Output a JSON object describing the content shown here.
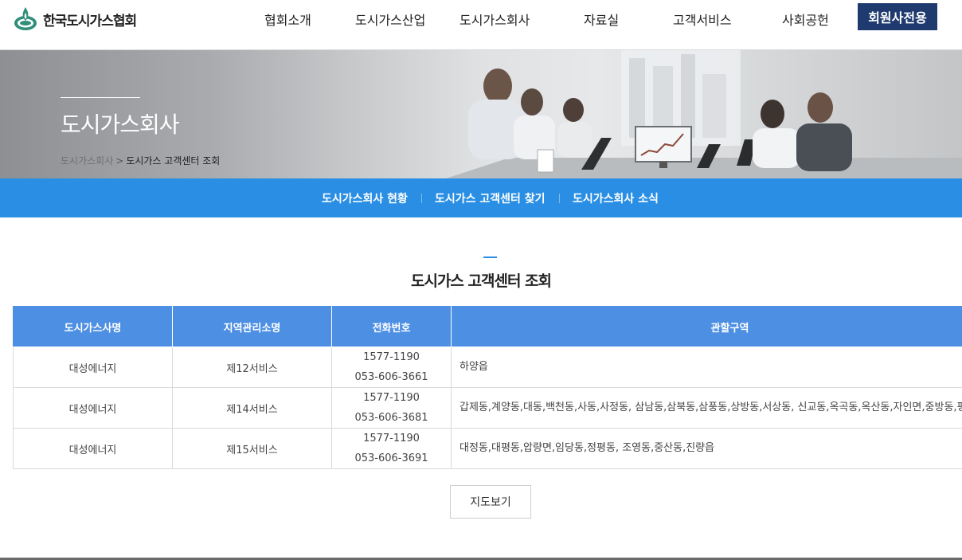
{
  "header": {
    "logo_text": "한국도시가스협회",
    "nav": [
      "협회소개",
      "도시가스산업",
      "도시가스회사",
      "자료실",
      "고객서비스",
      "사회공헌"
    ],
    "member_button": "회원사전용"
  },
  "banner": {
    "title": "도시가스회사",
    "breadcrumb": [
      "도시가스회사",
      "도시가스 고객센터 조회"
    ],
    "breadcrumb_separator": ">"
  },
  "subnav": {
    "items": [
      "도시가스회사 현황",
      "도시가스 고객센터 찾기",
      "도시가스회사 소식"
    ]
  },
  "content": {
    "title": "도시가스 고객센터 조회",
    "table": {
      "headers": [
        "도시가스사명",
        "지역관리소명",
        "전화번호",
        "관할구역"
      ],
      "rows": [
        {
          "company": "대성에너지",
          "office": "제12서비스",
          "phone1": "1577-1190",
          "phone2": "053-606-3661",
          "area": "하양읍"
        },
        {
          "company": "대성에너지",
          "office": "제14서비스",
          "phone1": "1577-1190",
          "phone2": "053-606-3681",
          "area": "갑제동,계양동,대동,백천동,사동,사정동, 삼남동,삼북동,삼풍동,상방동,서상동, 신교동,옥곡동,옥산동,자인면,중방동,평산동"
        },
        {
          "company": "대성에너지",
          "office": "제15서비스",
          "phone1": "1577-1190",
          "phone2": "053-606-3691",
          "area": "대정동,대평동,압량면,임당동,정평동, 조영동,중산동,진량읍"
        }
      ]
    },
    "map_button": "지도보기"
  },
  "colors": {
    "navy": "#1e3a6e",
    "subnav_blue": "#2a8fe4",
    "table_header_blue": "#4d8fe3"
  }
}
